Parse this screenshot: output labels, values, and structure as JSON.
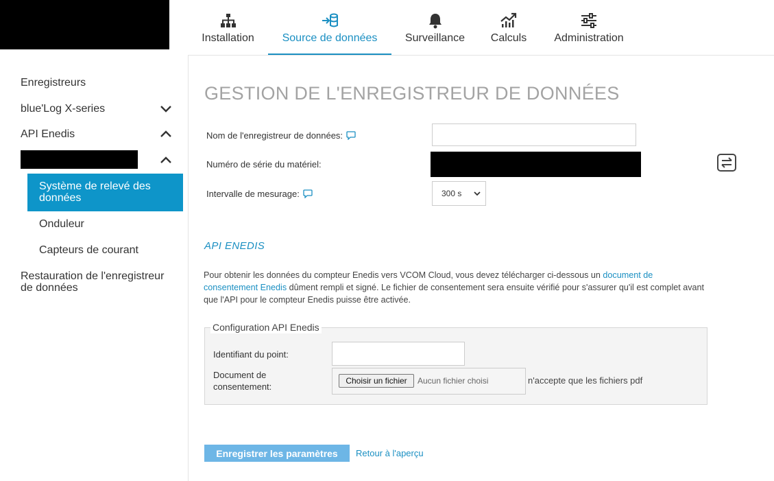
{
  "nav": {
    "tabs": [
      {
        "label": "Installation",
        "icon": "sitemap-icon"
      },
      {
        "label": "Source de données",
        "icon": "database-import-icon",
        "active": true
      },
      {
        "label": "Surveillance",
        "icon": "bell-icon"
      },
      {
        "label": "Calculs",
        "icon": "chart-line-icon"
      },
      {
        "label": "Administration",
        "icon": "sliders-icon"
      }
    ]
  },
  "sidebar": {
    "items": [
      {
        "label": "Enregistreurs"
      },
      {
        "label": "blue'Log X-series",
        "chevron": "down"
      },
      {
        "label": "API Enedis",
        "chevron": "up"
      }
    ],
    "sub_items": [
      {
        "label": "Système de relevé des données",
        "active": true
      },
      {
        "label": "Onduleur"
      },
      {
        "label": "Capteurs de courant"
      }
    ],
    "restore": "Restauration de l'enregistreur de données"
  },
  "main": {
    "title": "GESTION DE L'ENREGISTREUR DE DONNÉES",
    "form": {
      "name_label": "Nom de l'enregistreur de données:",
      "name_value": "",
      "serial_label": "Numéro de série du matériel:",
      "interval_label": "Intervalle de mesurage:",
      "interval_value": "300 s"
    },
    "api": {
      "heading": "API ENEDIS",
      "para_before": "Pour obtenir les données du compteur Enedis vers VCOM Cloud, vous devez télécharger ci-dessous un ",
      "para_link": "document de consentement Enedis",
      "para_after": " dûment rempli et signé. Le fichier de consentement sera ensuite vérifié pour s'assurer qu'il est complet avant que l'API pour le compteur Enedis puisse être activée.",
      "fieldset_legend": "Configuration API Enedis",
      "point_label": "Identifiant du point:",
      "point_value": "",
      "document_label": "Document de consentement:",
      "file_button": "Choisir un fichier",
      "file_none": "Aucun fichier choisi",
      "file_note": "n'accepte que les fichiers pdf"
    },
    "save_button": "Enregistrer les paramètres",
    "back_link": "Retour à l'aperçu"
  },
  "colors": {
    "accent": "#1a8fc2",
    "active_side": "#0e95c9",
    "save_button": "#6db6e6"
  }
}
